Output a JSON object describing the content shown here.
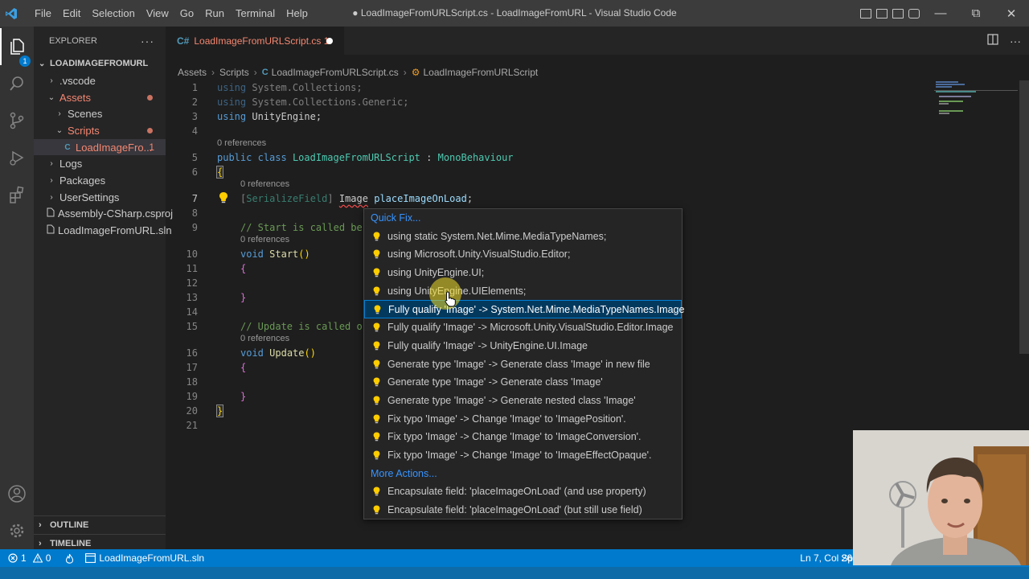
{
  "window": {
    "title": "● LoadImageFromURLScript.cs - LoadImageFromURL - Visual Studio Code",
    "menu": [
      "File",
      "Edit",
      "Selection",
      "View",
      "Go",
      "Run",
      "Terminal",
      "Help"
    ]
  },
  "activity_bar": {
    "explorer_badge": "1"
  },
  "sidebar": {
    "header": "EXPLORER",
    "header_more": "···",
    "project": "LOADIMAGEFROMURL",
    "tree": [
      {
        "label": ".vscode",
        "chev": "›",
        "indent": 1,
        "state": "normal"
      },
      {
        "label": "Assets",
        "chev": "⌄",
        "indent": 1,
        "state": "red-dot"
      },
      {
        "label": "Scenes",
        "chev": "›",
        "indent": 2,
        "state": "normal"
      },
      {
        "label": "Scripts",
        "chev": "⌄",
        "indent": 2,
        "state": "red-dot"
      },
      {
        "label": "LoadImageFro...",
        "chev": "",
        "indent": 3,
        "state": "selected",
        "count": "1"
      },
      {
        "label": "Logs",
        "chev": "›",
        "indent": 1,
        "state": "normal"
      },
      {
        "label": "Packages",
        "chev": "›",
        "indent": 1,
        "state": "normal"
      },
      {
        "label": "UserSettings",
        "chev": "›",
        "indent": 1,
        "state": "normal"
      },
      {
        "label": "Assembly-CSharp.csproj",
        "chev": "",
        "indent": 1,
        "state": "normal"
      },
      {
        "label": "LoadImageFromURL.sln",
        "chev": "",
        "indent": 1,
        "state": "normal"
      }
    ],
    "outline": "OUTLINE",
    "timeline": "TIMELINE"
  },
  "tab": {
    "icon": "C#",
    "label": "LoadImageFromURLScript.cs 1"
  },
  "breadcrumb": [
    "Assets",
    "Scripts",
    "LoadImageFromURLScript.cs",
    "LoadImageFromURLScript"
  ],
  "editor": {
    "codelens": "0 references",
    "lines": [
      {
        "n": "1",
        "text": "using System.Collections;"
      },
      {
        "n": "2",
        "text": "using System.Collections.Generic;"
      },
      {
        "n": "3",
        "text": "using UnityEngine;"
      },
      {
        "n": "4",
        "text": ""
      },
      {
        "n": "5",
        "text": "public class LoadImageFromURLScript : MonoBehaviour"
      },
      {
        "n": "6",
        "text": "{"
      },
      {
        "n": "7",
        "text": "[SerializeField] Image placeImageOnLoad;"
      },
      {
        "n": "8",
        "text": ""
      },
      {
        "n": "9",
        "text": "// Start is called be"
      },
      {
        "n": "10",
        "text": "void Start()"
      },
      {
        "n": "11",
        "text": "{"
      },
      {
        "n": "12",
        "text": ""
      },
      {
        "n": "13",
        "text": "}"
      },
      {
        "n": "14",
        "text": ""
      },
      {
        "n": "15",
        "text": "// Update is called o"
      },
      {
        "n": "16",
        "text": "void Update()"
      },
      {
        "n": "17",
        "text": "{"
      },
      {
        "n": "18",
        "text": ""
      },
      {
        "n": "19",
        "text": "}"
      },
      {
        "n": "20",
        "text": "}"
      },
      {
        "n": "21",
        "text": ""
      }
    ]
  },
  "quickfix": {
    "group1": "Quick Fix...",
    "items": [
      "using static System.Net.Mime.MediaTypeNames;",
      "using Microsoft.Unity.VisualStudio.Editor;",
      "using UnityEngine.UI;",
      "using UnityEngine.UIElements;",
      "Fully qualify 'Image' -> System.Net.Mime.MediaTypeNames.Image",
      "Fully qualify 'Image' -> Microsoft.Unity.VisualStudio.Editor.Image",
      "Fully qualify 'Image' -> UnityEngine.UI.Image",
      "Generate type 'Image' -> Generate class 'Image' in new file",
      "Generate type 'Image' -> Generate class 'Image'",
      "Generate type 'Image' -> Generate nested class 'Image'",
      "Fix typo 'Image' -> Change 'Image' to 'ImagePosition'.",
      "Fix typo 'Image' -> Change 'Image' to 'ImageConversion'.",
      "Fix typo 'Image' -> Change 'Image' to 'ImageEffectOpaque'."
    ],
    "focused_index": 4,
    "group2": "More Actions...",
    "more_items": [
      "Encapsulate field: 'placeImageOnLoad' (and use property)",
      "Encapsulate field: 'placeImageOnLoad' (but still use field)"
    ]
  },
  "statusbar": {
    "errors": "1",
    "warnings": "0",
    "solution": "LoadImageFromURL.sln",
    "position": "Ln 7, Col 26",
    "spaces": "Sp"
  },
  "colors": {
    "accent": "#007acc",
    "error": "#f48771",
    "link": "#3794ff",
    "bulb": "#ffcc00"
  }
}
